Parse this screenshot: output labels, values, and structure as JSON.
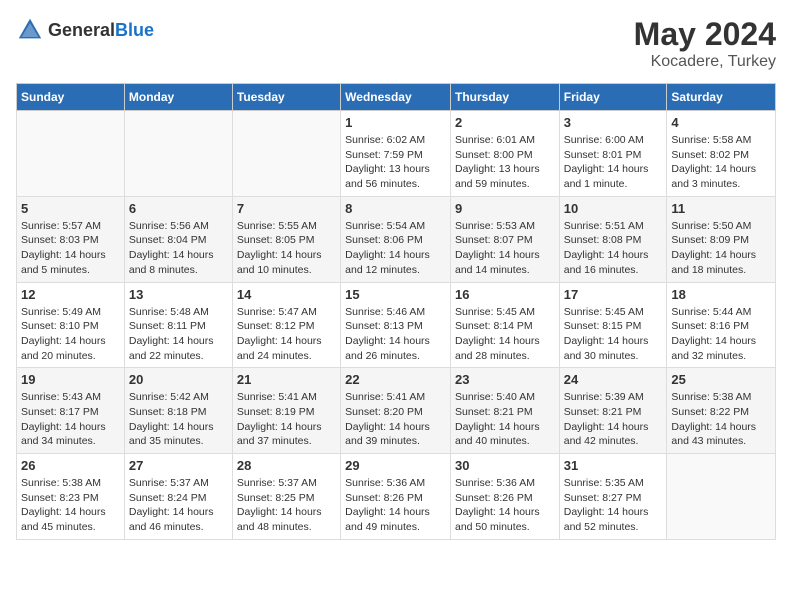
{
  "header": {
    "logo_general": "General",
    "logo_blue": "Blue",
    "month": "May 2024",
    "location": "Kocadere, Turkey"
  },
  "weekdays": [
    "Sunday",
    "Monday",
    "Tuesday",
    "Wednesday",
    "Thursday",
    "Friday",
    "Saturday"
  ],
  "weeks": [
    [
      {
        "day": "",
        "sunrise": "",
        "sunset": "",
        "daylight": ""
      },
      {
        "day": "",
        "sunrise": "",
        "sunset": "",
        "daylight": ""
      },
      {
        "day": "",
        "sunrise": "",
        "sunset": "",
        "daylight": ""
      },
      {
        "day": "1",
        "sunrise": "Sunrise: 6:02 AM",
        "sunset": "Sunset: 7:59 PM",
        "daylight": "Daylight: 13 hours and 56 minutes."
      },
      {
        "day": "2",
        "sunrise": "Sunrise: 6:01 AM",
        "sunset": "Sunset: 8:00 PM",
        "daylight": "Daylight: 13 hours and 59 minutes."
      },
      {
        "day": "3",
        "sunrise": "Sunrise: 6:00 AM",
        "sunset": "Sunset: 8:01 PM",
        "daylight": "Daylight: 14 hours and 1 minute."
      },
      {
        "day": "4",
        "sunrise": "Sunrise: 5:58 AM",
        "sunset": "Sunset: 8:02 PM",
        "daylight": "Daylight: 14 hours and 3 minutes."
      }
    ],
    [
      {
        "day": "5",
        "sunrise": "Sunrise: 5:57 AM",
        "sunset": "Sunset: 8:03 PM",
        "daylight": "Daylight: 14 hours and 5 minutes."
      },
      {
        "day": "6",
        "sunrise": "Sunrise: 5:56 AM",
        "sunset": "Sunset: 8:04 PM",
        "daylight": "Daylight: 14 hours and 8 minutes."
      },
      {
        "day": "7",
        "sunrise": "Sunrise: 5:55 AM",
        "sunset": "Sunset: 8:05 PM",
        "daylight": "Daylight: 14 hours and 10 minutes."
      },
      {
        "day": "8",
        "sunrise": "Sunrise: 5:54 AM",
        "sunset": "Sunset: 8:06 PM",
        "daylight": "Daylight: 14 hours and 12 minutes."
      },
      {
        "day": "9",
        "sunrise": "Sunrise: 5:53 AM",
        "sunset": "Sunset: 8:07 PM",
        "daylight": "Daylight: 14 hours and 14 minutes."
      },
      {
        "day": "10",
        "sunrise": "Sunrise: 5:51 AM",
        "sunset": "Sunset: 8:08 PM",
        "daylight": "Daylight: 14 hours and 16 minutes."
      },
      {
        "day": "11",
        "sunrise": "Sunrise: 5:50 AM",
        "sunset": "Sunset: 8:09 PM",
        "daylight": "Daylight: 14 hours and 18 minutes."
      }
    ],
    [
      {
        "day": "12",
        "sunrise": "Sunrise: 5:49 AM",
        "sunset": "Sunset: 8:10 PM",
        "daylight": "Daylight: 14 hours and 20 minutes."
      },
      {
        "day": "13",
        "sunrise": "Sunrise: 5:48 AM",
        "sunset": "Sunset: 8:11 PM",
        "daylight": "Daylight: 14 hours and 22 minutes."
      },
      {
        "day": "14",
        "sunrise": "Sunrise: 5:47 AM",
        "sunset": "Sunset: 8:12 PM",
        "daylight": "Daylight: 14 hours and 24 minutes."
      },
      {
        "day": "15",
        "sunrise": "Sunrise: 5:46 AM",
        "sunset": "Sunset: 8:13 PM",
        "daylight": "Daylight: 14 hours and 26 minutes."
      },
      {
        "day": "16",
        "sunrise": "Sunrise: 5:45 AM",
        "sunset": "Sunset: 8:14 PM",
        "daylight": "Daylight: 14 hours and 28 minutes."
      },
      {
        "day": "17",
        "sunrise": "Sunrise: 5:45 AM",
        "sunset": "Sunset: 8:15 PM",
        "daylight": "Daylight: 14 hours and 30 minutes."
      },
      {
        "day": "18",
        "sunrise": "Sunrise: 5:44 AM",
        "sunset": "Sunset: 8:16 PM",
        "daylight": "Daylight: 14 hours and 32 minutes."
      }
    ],
    [
      {
        "day": "19",
        "sunrise": "Sunrise: 5:43 AM",
        "sunset": "Sunset: 8:17 PM",
        "daylight": "Daylight: 14 hours and 34 minutes."
      },
      {
        "day": "20",
        "sunrise": "Sunrise: 5:42 AM",
        "sunset": "Sunset: 8:18 PM",
        "daylight": "Daylight: 14 hours and 35 minutes."
      },
      {
        "day": "21",
        "sunrise": "Sunrise: 5:41 AM",
        "sunset": "Sunset: 8:19 PM",
        "daylight": "Daylight: 14 hours and 37 minutes."
      },
      {
        "day": "22",
        "sunrise": "Sunrise: 5:41 AM",
        "sunset": "Sunset: 8:20 PM",
        "daylight": "Daylight: 14 hours and 39 minutes."
      },
      {
        "day": "23",
        "sunrise": "Sunrise: 5:40 AM",
        "sunset": "Sunset: 8:21 PM",
        "daylight": "Daylight: 14 hours and 40 minutes."
      },
      {
        "day": "24",
        "sunrise": "Sunrise: 5:39 AM",
        "sunset": "Sunset: 8:21 PM",
        "daylight": "Daylight: 14 hours and 42 minutes."
      },
      {
        "day": "25",
        "sunrise": "Sunrise: 5:38 AM",
        "sunset": "Sunset: 8:22 PM",
        "daylight": "Daylight: 14 hours and 43 minutes."
      }
    ],
    [
      {
        "day": "26",
        "sunrise": "Sunrise: 5:38 AM",
        "sunset": "Sunset: 8:23 PM",
        "daylight": "Daylight: 14 hours and 45 minutes."
      },
      {
        "day": "27",
        "sunrise": "Sunrise: 5:37 AM",
        "sunset": "Sunset: 8:24 PM",
        "daylight": "Daylight: 14 hours and 46 minutes."
      },
      {
        "day": "28",
        "sunrise": "Sunrise: 5:37 AM",
        "sunset": "Sunset: 8:25 PM",
        "daylight": "Daylight: 14 hours and 48 minutes."
      },
      {
        "day": "29",
        "sunrise": "Sunrise: 5:36 AM",
        "sunset": "Sunset: 8:26 PM",
        "daylight": "Daylight: 14 hours and 49 minutes."
      },
      {
        "day": "30",
        "sunrise": "Sunrise: 5:36 AM",
        "sunset": "Sunset: 8:26 PM",
        "daylight": "Daylight: 14 hours and 50 minutes."
      },
      {
        "day": "31",
        "sunrise": "Sunrise: 5:35 AM",
        "sunset": "Sunset: 8:27 PM",
        "daylight": "Daylight: 14 hours and 52 minutes."
      },
      {
        "day": "",
        "sunrise": "",
        "sunset": "",
        "daylight": ""
      }
    ]
  ]
}
